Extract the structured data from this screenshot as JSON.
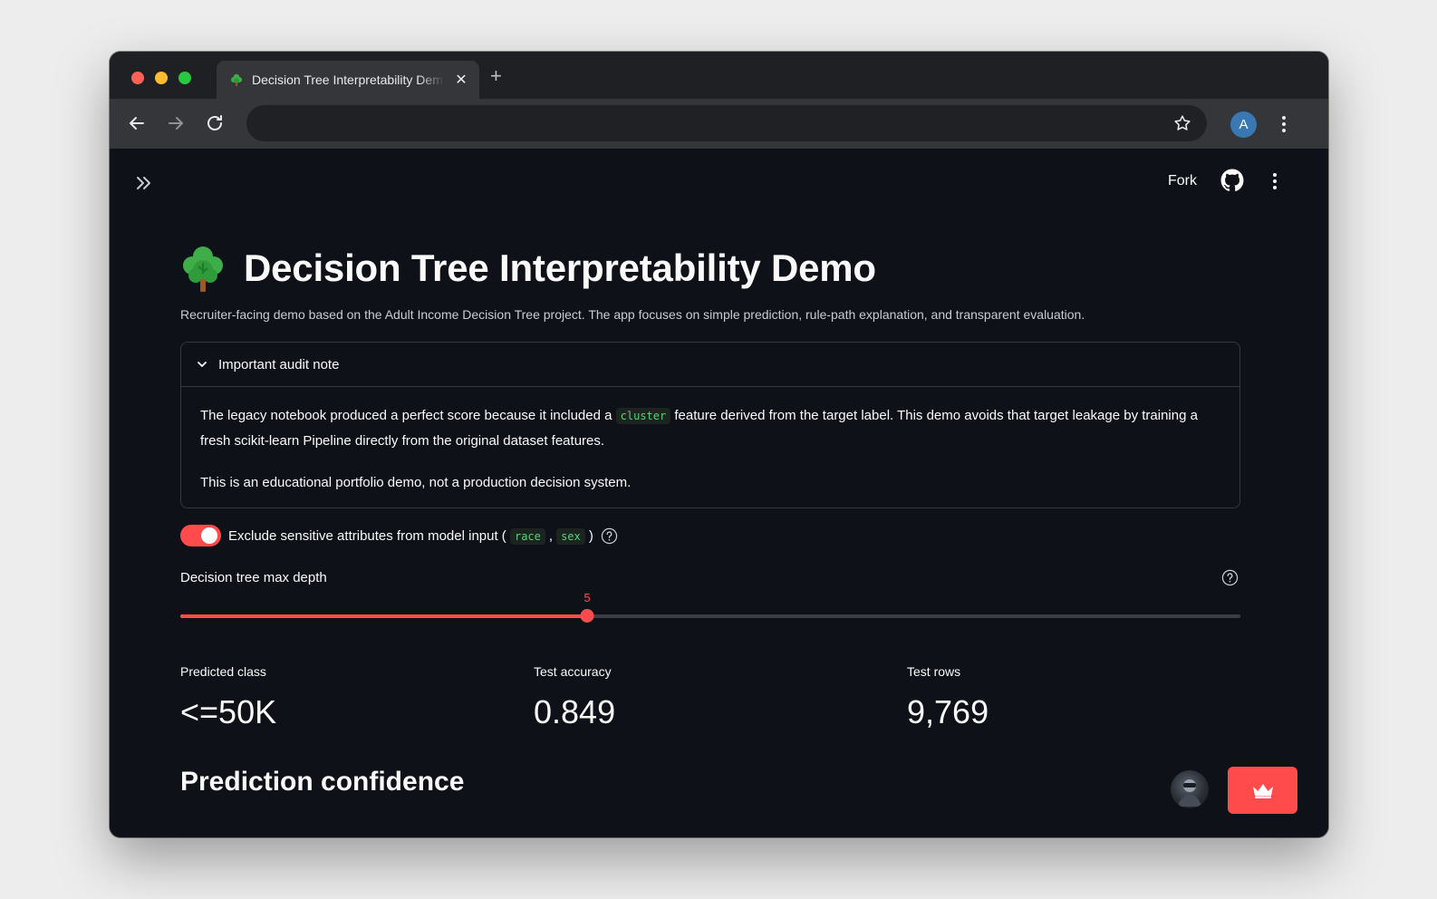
{
  "browser": {
    "tab_title": "Decision Tree Interpretability Demo",
    "tab_close_glyph": "✕",
    "new_tab_glyph": "+",
    "address_value": "",
    "profile_initial": "A"
  },
  "app": {
    "header": {
      "fork_label": "Fork"
    },
    "title": "Decision Tree Interpretability Demo",
    "subtitle": "Recruiter-facing demo based on the Adult Income Decision Tree project. The app focuses on simple prediction, rule-path explanation, and transparent evaluation.",
    "audit_note": {
      "label": "Important audit note",
      "p1_before": "The legacy notebook produced a perfect score because it included a ",
      "p1_code": "cluster",
      "p1_after": " feature derived from the target label. This demo avoids that target leakage by training a fresh scikit-learn Pipeline directly from the original dataset features.",
      "p2": "This is an educational portfolio demo, not a production decision system."
    },
    "toggle": {
      "label_before": "Exclude sensitive attributes from model input (",
      "code1": "race",
      "comma": ",",
      "code2": "sex",
      "label_after": ")",
      "checked": true
    },
    "slider": {
      "label": "Decision tree max depth",
      "value": 5,
      "value_label": "5",
      "fraction": 0.384
    },
    "metrics": [
      {
        "label": "Predicted class",
        "value": "<=50K"
      },
      {
        "label": "Test accuracy",
        "value": "0.849"
      },
      {
        "label": "Test rows",
        "value": "9,769"
      }
    ],
    "section_title": "Prediction confidence"
  },
  "colors": {
    "accent": "#ff4b4b",
    "background": "#0e1117",
    "code_text": "#5ad17a"
  },
  "icons": {
    "tab_favicon": "tree-icon",
    "back": "arrow-left-icon",
    "forward": "arrow-right-icon",
    "reload": "reload-icon",
    "bookmark": "star-icon",
    "chrome_menu": "kebab-menu-icon",
    "sidebar": "double-chevron-right-icon",
    "github": "github-icon",
    "help": "question-circle-icon",
    "crown": "crown-icon"
  }
}
